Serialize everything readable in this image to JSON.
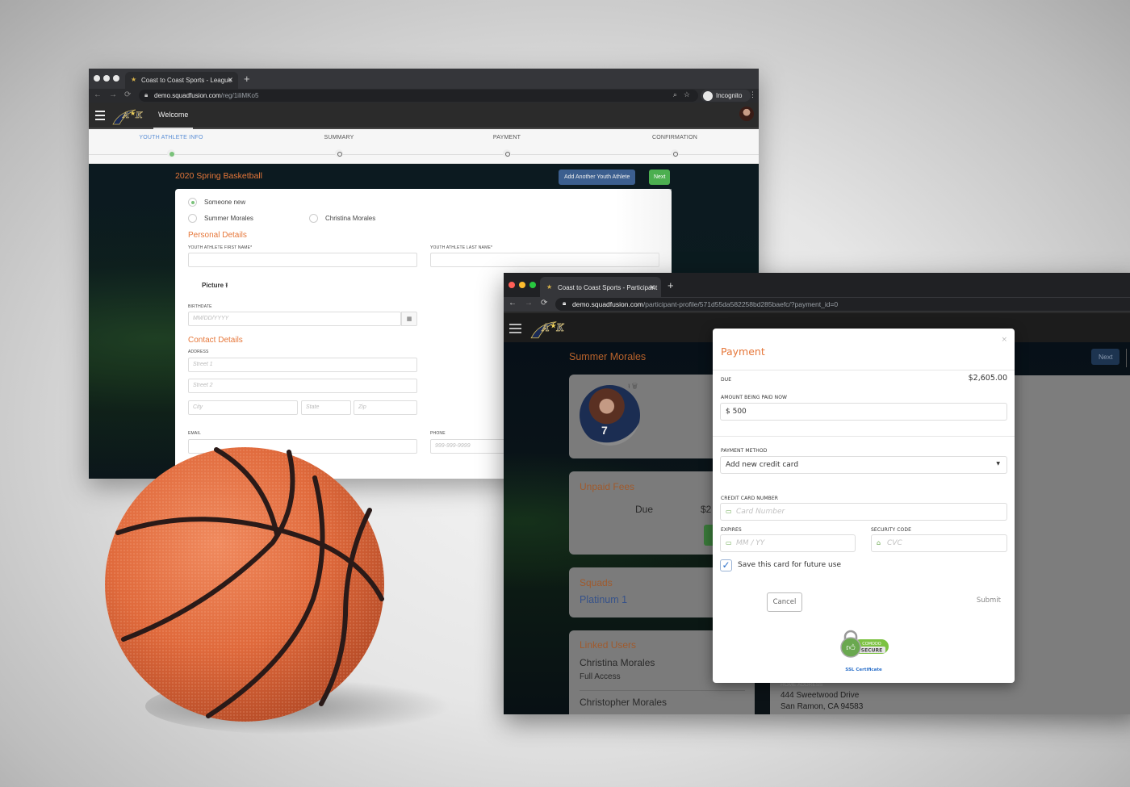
{
  "registration_window": {
    "traffic_lights": [
      "close",
      "minimize",
      "maximize"
    ],
    "tab": {
      "title": "Coast to Coast Sports - League",
      "favicon": "team-logo-icon",
      "close_glyph": "✕"
    },
    "new_tab_glyph": "+",
    "nav": {
      "back": "←",
      "forward": "→",
      "reload": "⟳"
    },
    "address": {
      "domain": "demo.squadfusion.com",
      "path": "/reg/1iliMKo5"
    },
    "address_icons": {
      "zoom": "⌕",
      "bookmark": "☆"
    },
    "incognito_label": "Incognito",
    "menu_glyph": "⋮",
    "app_nav": {
      "logo_text": "A★K",
      "welcome_tab": "Welcome"
    },
    "steps": [
      {
        "label": "YOUTH ATHLETE INFO",
        "active": true
      },
      {
        "label": "SUMMARY",
        "active": false
      },
      {
        "label": "PAYMENT",
        "active": false
      },
      {
        "label": "CONFIRMATION",
        "active": false
      }
    ],
    "season_title": "2020 Spring Basketball",
    "add_athlete_button": "Add Another Youth Athlete",
    "next_button": "Next",
    "athlete_options": [
      {
        "label": "Someone new",
        "selected": true
      },
      {
        "label": "Summer Morales",
        "selected": false
      },
      {
        "label": "Christina Morales",
        "selected": false
      }
    ],
    "personal_details": {
      "title": "Personal Details",
      "first_name_label": "YOUTH ATHLETE FIRST NAME*",
      "first_name_value": "",
      "last_name_label": "YOUTH ATHLETE LAST NAME*",
      "last_name_value": "",
      "picture_label": "Picture",
      "picture_icon": "⭱",
      "birthdate_label": "BIRTHDATE",
      "birthdate_placeholder": "MM/DD/YYYY",
      "calendar_icon": "▦"
    },
    "contact_details": {
      "title": "Contact Details",
      "address_label": "ADDRESS",
      "street1_placeholder": "Street 1",
      "street2_placeholder": "Street 2",
      "city_placeholder": "City",
      "state_placeholder": "State",
      "zip_placeholder": "Zip",
      "email_label": "EMAIL",
      "email_value": "",
      "phone_label": "PHONE",
      "phone_placeholder": "999-999-9999"
    }
  },
  "profile_window": {
    "traffic_lights": {
      "close": "#ff5f57",
      "minimize": "#febc2e",
      "maximize": "#28c840"
    },
    "tab": {
      "title": "Coast to Coast Sports - Participant",
      "close_glyph": "✕"
    },
    "new_tab_glyph": "+",
    "nav": {
      "back": "←",
      "forward": "→",
      "reload": "⟳"
    },
    "address": {
      "domain": "demo.squadfusion.com",
      "path": "/participant-profile/571d55da582258bd285baefc/?payment_id=0"
    },
    "athlete_name": "Summer Morales",
    "photo_icons": "⭱🗑",
    "unpaid_fees": {
      "title": "Unpaid Fees",
      "due_label": "Due",
      "due_amount_partial": "$2"
    },
    "squads": {
      "title": "Squads",
      "squad": "Platinum 1"
    },
    "linked_users": {
      "title": "Linked Users",
      "users": [
        {
          "name": "Christina Morales",
          "access": "Full Access"
        },
        {
          "name": "Christopher Morales",
          "access": ""
        }
      ]
    },
    "next_button": "Next",
    "home_address": {
      "label": "HOME ADDRESS",
      "line1": "444 Sweetwood Drive",
      "line2": "San Ramon, CA 94583"
    }
  },
  "payment_modal": {
    "title": "Payment",
    "close_glyph": "×",
    "due_label": "DUE",
    "due_amount": "$2,605.00",
    "amount_label": "AMOUNT BEING PAID NOW",
    "amount_value": "$ 500",
    "method_label": "PAYMENT METHOD",
    "method_selected": "Add new credit card",
    "card_number_label": "CREDIT CARD NUMBER",
    "card_number_placeholder": "Card Number",
    "expires_label": "EXPIRES",
    "expires_placeholder": "MM / YY",
    "security_label": "SECURITY CODE",
    "security_placeholder": "CVC",
    "save_card_checked": true,
    "save_card_check_glyph": "✓",
    "save_card_label": "Save this card for future use",
    "cancel_button": "Cancel",
    "submit_button": "Submit",
    "badge": {
      "line1": "COMODO",
      "line2": "SECURE"
    },
    "ssl_link": "SSL Certificate"
  },
  "colors": {
    "accent_orange": "#e6773a",
    "success_green": "#4caf50",
    "primary_blue": "#3c5f8f",
    "link_blue": "#2a6fc9"
  }
}
